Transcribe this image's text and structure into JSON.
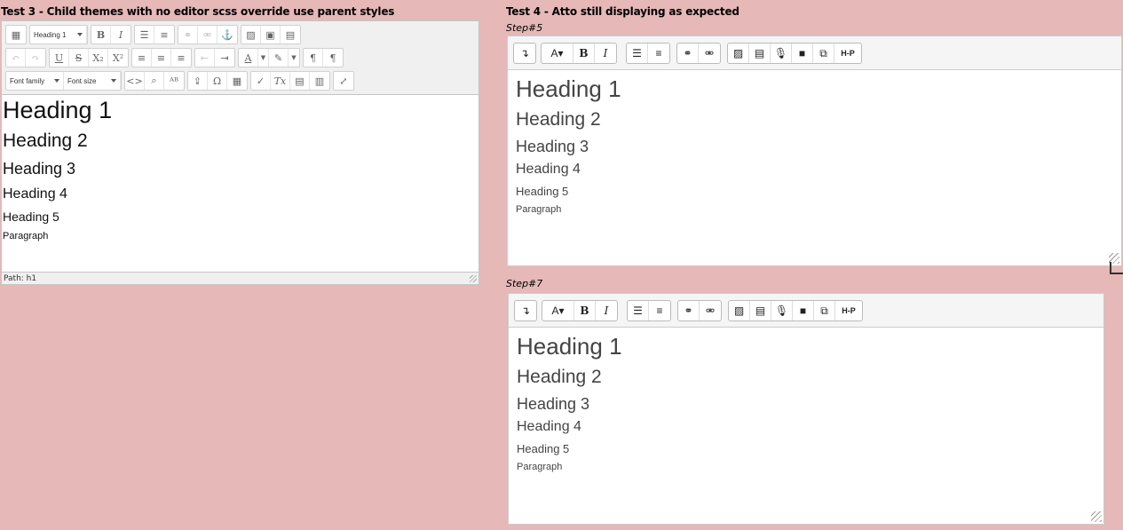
{
  "test3": {
    "caption": "Test 3 - Child themes with no editor scss override use parent styles",
    "format_select": "Heading 1",
    "font_family_select": "Font family",
    "font_size_select": "Font size",
    "content": [
      "Heading 1",
      "Heading 2",
      "Heading 3",
      "Heading 4",
      "Heading 5",
      "Paragraph"
    ],
    "path": "Path: h1"
  },
  "test4": {
    "caption": "Test 4 - Atto still displaying as expected",
    "step5": "Step#5",
    "step7": "Step#7",
    "content": [
      "Heading 1",
      "Heading 2",
      "Heading 3",
      "Heading 4",
      "Heading 5",
      "Paragraph"
    ],
    "toolbar": {
      "collapse": "↴",
      "style": "A▾",
      "bold": "B",
      "italic": "I",
      "h5p": "H-P"
    }
  },
  "icons": [
    "code-icon",
    "undo-icon",
    "redo-icon",
    "bullet-list-icon",
    "numbered-list-icon",
    "link-icon",
    "unlink-icon",
    "image-icon",
    "media-icon",
    "microphone-icon",
    "video-icon",
    "manage-files-icon",
    "fullscreen-icon"
  ],
  "colors": {
    "page_bg": "#e6b8b8",
    "toolbar_bg": "#f5f5f5"
  }
}
